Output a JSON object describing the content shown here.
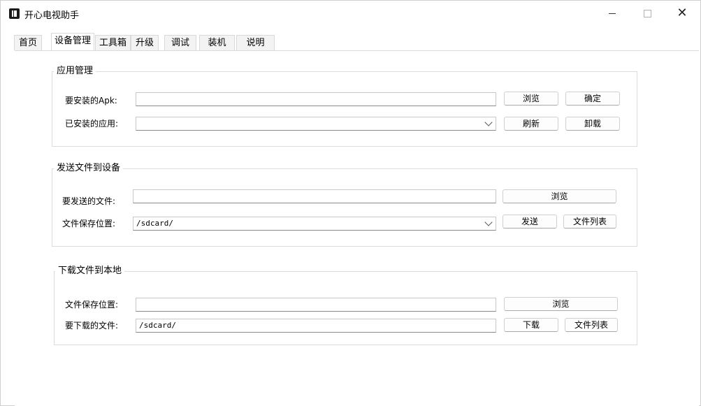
{
  "window": {
    "title": "开心电视助手",
    "minimize_icon": "minimize-icon",
    "maximize_icon": "maximize-icon",
    "close_icon": "close-icon",
    "close_glyph": "✕"
  },
  "tabs": [
    {
      "label": "首页"
    },
    {
      "label": "设备管理",
      "active": true
    },
    {
      "label": "工具箱"
    },
    {
      "label": "升级"
    },
    {
      "label": "调试"
    },
    {
      "label": "装机"
    },
    {
      "label": "说明"
    }
  ],
  "app_management": {
    "title": "应用管理",
    "apk_label": "要安装的Apk:",
    "apk_value": "",
    "browse": "浏览",
    "confirm": "确定",
    "installed_label": "已安装的应用:",
    "installed_value": "",
    "refresh": "刷新",
    "uninstall": "卸载"
  },
  "send_file": {
    "title": "发送文件到设备",
    "file_label": "要发送的文件:",
    "file_value": "",
    "browse": "浏览",
    "save_label": "文件保存位置:",
    "save_value": "/sdcard/",
    "send": "发送",
    "file_list": "文件列表"
  },
  "download_file": {
    "title": "下载文件到本地",
    "save_label": "文件保存位置:",
    "save_value": "",
    "browse": "浏览",
    "file_label": "要下载的文件:",
    "file_value": "/sdcard/",
    "download": "下载",
    "file_list": "文件列表"
  }
}
